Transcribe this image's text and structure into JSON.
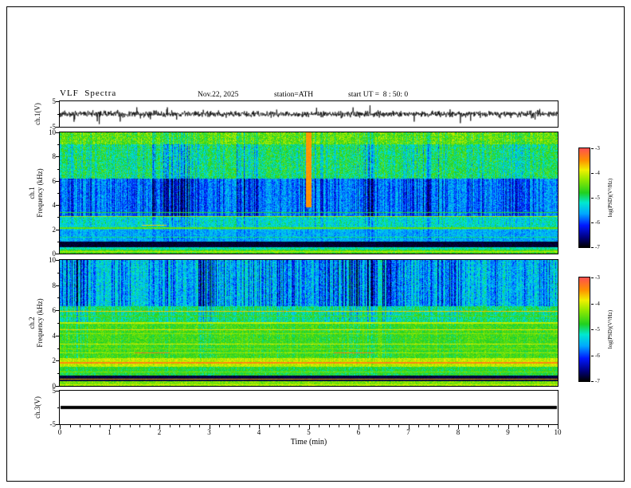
{
  "header": {
    "title": "VLF  Spectra",
    "date": "Nov.22, 2025",
    "station": "station=ATH",
    "start_ut": "start UT =  8 : 50: 0"
  },
  "time_axis": {
    "label": "Time  (min)",
    "min": 0,
    "max": 10,
    "ticks": [
      0,
      1,
      2,
      3,
      4,
      5,
      6,
      7,
      8,
      9,
      10
    ]
  },
  "colorbar": {
    "label": "log(PSD)(V²/Hz)",
    "ticks": [
      -3,
      -4,
      -5,
      -6,
      -7
    ],
    "min": -7,
    "max": -3,
    "stops": [
      [
        0,
        "#000000"
      ],
      [
        0.1,
        "#000080"
      ],
      [
        0.22,
        "#0018ff"
      ],
      [
        0.34,
        "#00a8ff"
      ],
      [
        0.45,
        "#00e8d0"
      ],
      [
        0.55,
        "#20d020"
      ],
      [
        0.68,
        "#90e800"
      ],
      [
        0.78,
        "#f0f000"
      ],
      [
        0.88,
        "#ff9000"
      ],
      [
        1,
        "#ff5050"
      ]
    ]
  },
  "chart_data": [
    {
      "id": "ch1_waveform",
      "type": "line",
      "ylabel": "ch.1(V)",
      "x_label": "Time (min)",
      "x_range": [
        0,
        10
      ],
      "y_range": [
        -5,
        5
      ],
      "y_tick_values": [
        5,
        -5
      ],
      "y_tick_labels": [
        "5",
        "-5"
      ],
      "description": "Broadband ELF/VLF time series: continuous noise band of roughly ±1.5 V about 0 V with sporadic impulsive spikes reaching about ±4 V over the full 10 minutes.",
      "gen": {
        "seed": 11,
        "n": 1500,
        "sigma": 0.55,
        "spike_prob": 0.02,
        "spike_amp": 2.6,
        "line_width": 0.8
      }
    },
    {
      "id": "ch1_spectrogram",
      "type": "heatmap",
      "ylabel_lines": [
        "ch.1",
        "Frequency (kHz)"
      ],
      "x_label": "Time (min)",
      "x_range": [
        0,
        10
      ],
      "y_range": [
        0,
        10
      ],
      "y_ticks": [
        0,
        2,
        4,
        6,
        8,
        10
      ],
      "z_label": "log(PSD)(V²/Hz)",
      "z_range": [
        -7,
        -3
      ],
      "description": "0-10 kHz spectrogram: dense dark-blue vertical dropouts between ~3-6 kHz on a blue-cyan background, green-yellow background above ~6 kHz, enhanced horizontal lines near 3.0 and 2.1 kHz, near-black quiet band 0.55-1 kHz, thin bright rows below 0.3 kHz, a red/brown segment near 2.35 kHz around t=1.7-2.1 min and a red transient near t=5 min above ~4 kHz.",
      "gen": {
        "seed": 21,
        "streak_cell": 26,
        "bands": [
          [
            9,
            10,
            -4.35,
            0.45,
            1.0
          ],
          [
            6.2,
            9,
            -4.75,
            0.45,
            1.35
          ],
          [
            3,
            6.2,
            -5.55,
            0.35,
            1.6
          ],
          [
            2,
            3,
            -5.1,
            0.35,
            0.9
          ],
          [
            1,
            2,
            -5.5,
            0.3,
            0.5
          ],
          [
            0.55,
            1,
            -6.85,
            0.12,
            0
          ],
          [
            0.3,
            0.55,
            -5.1,
            0.3,
            0.2
          ],
          [
            0,
            0.3,
            -4.6,
            0.35,
            0.2
          ]
        ],
        "lines": [
          [
            3.05,
            0.1,
            -4.2
          ],
          [
            2.1,
            0.08,
            -4.5
          ],
          [
            3.4,
            0.06,
            -4.8
          ],
          [
            1.35,
            0.07,
            -5.0
          ],
          [
            0.15,
            0.08,
            -4.1
          ],
          [
            2.35,
            0.09,
            -3.8,
            1.65,
            2.15
          ]
        ],
        "features": [
          [
            4.95,
            5.06,
            3.8,
            10,
            -3.5
          ]
        ]
      }
    },
    {
      "id": "ch2_spectrogram",
      "type": "heatmap",
      "ylabel_lines": [
        "ch.2",
        "Frequency (kHz)"
      ],
      "x_label": "Time (min)",
      "x_range": [
        0,
        10
      ],
      "y_range": [
        0,
        10
      ],
      "y_ticks": [
        0,
        2,
        4,
        6,
        8,
        10
      ],
      "z_label": "log(PSD)(V²/Hz)",
      "z_range": [
        -7,
        -3
      ],
      "description": "0-10 kHz spectrogram: blue vertical dropouts above ~6.3 kHz on a cyan-green background, yellow-green 2-5 kHz with bright horizontal lines near 5.9, 5.0, 4.45, 3.3 and 2.6 kHz (red segments at 2.6 kHz near t=1.5-2.2 and 5.5-6.3 min), strong yellow band 1.5-2.2 kHz with a red line near 1.8 kHz, near-black quiet band 0.35-0.8 kHz containing a red line near 0.55 kHz, bright rows below 0.35 kHz.",
      "gen": {
        "seed": 37,
        "streak_cell": 26,
        "bands": [
          [
            6.3,
            10,
            -5.25,
            0.4,
            1.6
          ],
          [
            5,
            6.3,
            -4.8,
            0.35,
            0.9
          ],
          [
            2.2,
            5,
            -4.55,
            0.3,
            0.5
          ],
          [
            1.5,
            2.2,
            -4.05,
            0.25,
            0.25
          ],
          [
            0.8,
            1.5,
            -4.75,
            0.3,
            0.25
          ],
          [
            0.35,
            0.8,
            -6.8,
            0.12,
            0
          ],
          [
            0,
            0.35,
            -4.35,
            0.3,
            0.1
          ]
        ],
        "lines": [
          [
            5.92,
            0.08,
            -3.7
          ],
          [
            5.55,
            0.05,
            -4.6
          ],
          [
            5.0,
            0.07,
            -4.1
          ],
          [
            4.45,
            0.08,
            -3.8
          ],
          [
            4.15,
            0.05,
            -4.3
          ],
          [
            3.3,
            0.07,
            -4.0
          ],
          [
            2.95,
            0.05,
            -4.4
          ],
          [
            2.62,
            0.08,
            -4.2
          ],
          [
            2.62,
            0.1,
            -3.3,
            1.5,
            2.2
          ],
          [
            2.62,
            0.1,
            -3.3,
            5.5,
            6.3
          ],
          [
            1.83,
            0.09,
            -3.4
          ],
          [
            1.1,
            0.05,
            -4.4
          ],
          [
            0.55,
            0.07,
            -3.6
          ],
          [
            0.12,
            0.07,
            -4.0
          ]
        ],
        "features": []
      }
    },
    {
      "id": "ch3_waveform",
      "type": "line",
      "ylabel": "ch.3(V)",
      "x_label": "Time (min)",
      "x_range": [
        0,
        10
      ],
      "y_range": [
        -5,
        5
      ],
      "y_tick_values": [
        5,
        -5
      ],
      "y_tick_labels": [
        "5",
        "-5"
      ],
      "description": "Channel 3 is flat at 0 V for the whole interval (no signal), drawn as a thick solid black horizontal line.",
      "gen": {
        "constant": 0,
        "line_width": 4
      }
    }
  ]
}
